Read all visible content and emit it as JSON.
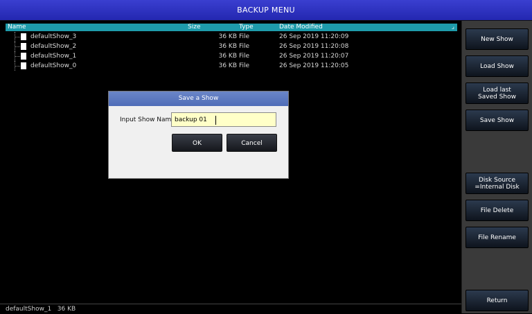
{
  "title": "BACKUP MENU",
  "columns": {
    "name": "Name",
    "size": "Size",
    "type": "Type",
    "date": "Date Modified"
  },
  "files": [
    {
      "name": "defaultShow_3",
      "size": "36 KB",
      "type": "File",
      "date": "26 Sep 2019 11:20:09"
    },
    {
      "name": "defaultShow_2",
      "size": "36 KB",
      "type": "File",
      "date": "26 Sep 2019 11:20:08"
    },
    {
      "name": "defaultShow_1",
      "size": "36 KB",
      "type": "File",
      "date": "26 Sep 2019 11:20:07"
    },
    {
      "name": "defaultShow_0",
      "size": "36 KB",
      "type": "File",
      "date": "26 Sep 2019 11:20:05"
    }
  ],
  "status": "defaultShow_1   36 KB",
  "dialog": {
    "title": "Save a Show",
    "label": "Input Show Name:",
    "value": "backup 01",
    "ok": "OK",
    "cancel": "Cancel"
  },
  "sidebar": {
    "new_show": "New Show",
    "load_show": "Load Show",
    "load_last": "Load last\nSaved Show",
    "save_show": "Save Show",
    "disk_source": "Disk Source\n=Internal Disk",
    "file_delete": "File Delete",
    "file_rename": "File Rename",
    "return": "Return"
  }
}
